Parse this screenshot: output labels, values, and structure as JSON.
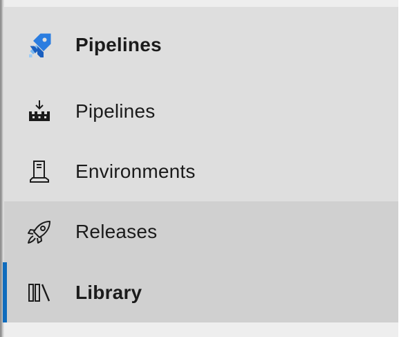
{
  "sidebar": {
    "header": {
      "label": "Pipelines",
      "icon": "azure-pipelines-logo-icon",
      "accent": "#2a7fd4"
    },
    "items": [
      {
        "label": "Pipelines",
        "icon": "pipelines-icon",
        "selected": false
      },
      {
        "label": "Environments",
        "icon": "environments-icon",
        "selected": false
      },
      {
        "label": "Releases",
        "icon": "rocket-icon",
        "selected": false
      },
      {
        "label": "Library",
        "icon": "library-icon",
        "selected": true
      }
    ],
    "colors": {
      "background": "#dedede",
      "hover": "#d0d0d0",
      "selection": "#0f6cbd",
      "text": "#1b1b1b"
    }
  }
}
